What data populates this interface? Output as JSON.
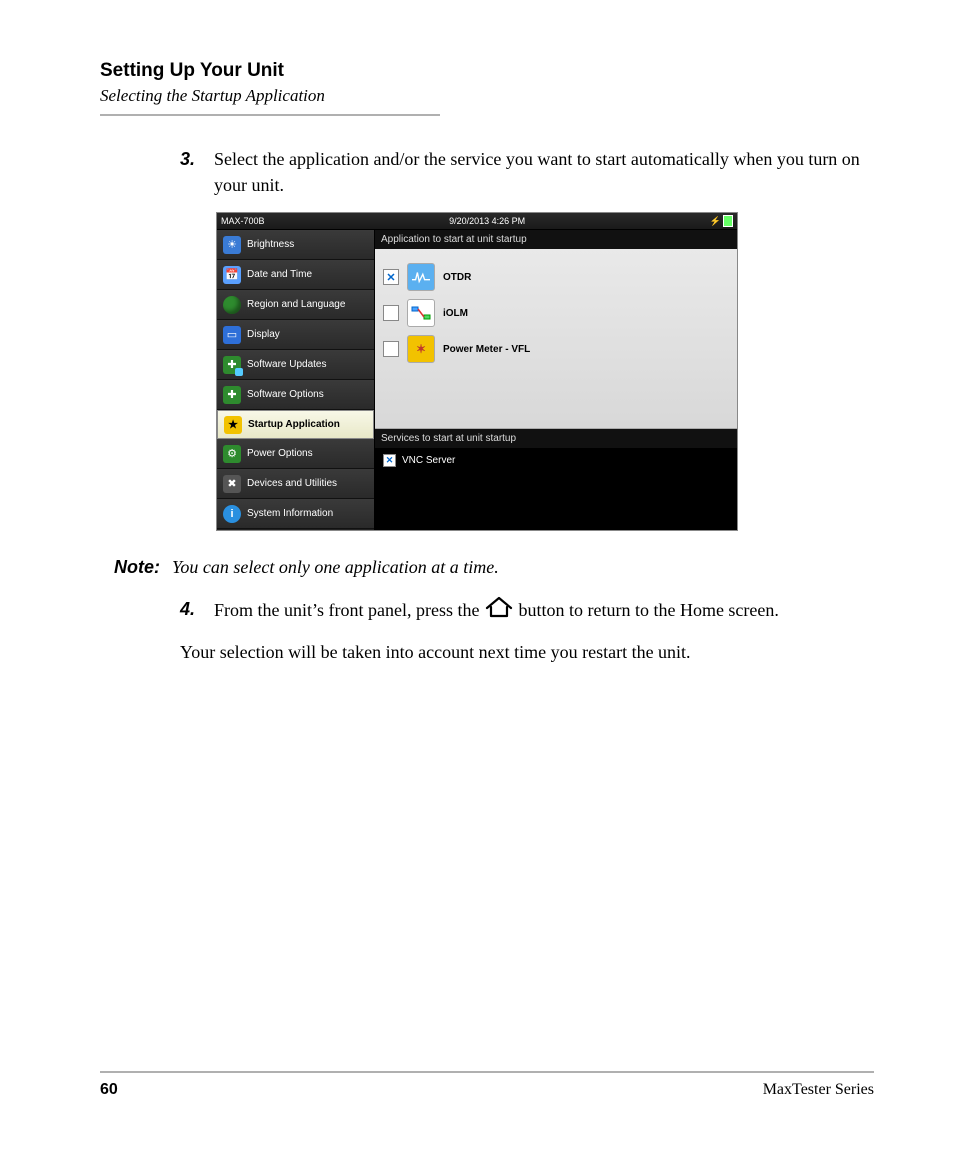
{
  "header": {
    "title": "Setting Up Your Unit",
    "subtitle": "Selecting the Startup Application"
  },
  "steps": {
    "s3": {
      "num": "3.",
      "text": "Select the application and/or the service you want to start automatically when you turn on your unit."
    },
    "s4": {
      "num": "4.",
      "pre": "From the unit’s front panel, press the ",
      "post": " button to return to the Home screen."
    }
  },
  "note": {
    "label": "Note:",
    "text": "You can select only one application at a time."
  },
  "closing": "Your selection will be taken into account next time you restart the unit.",
  "screenshot": {
    "device": "MAX-700B",
    "datetime": "9/20/2013 4:26 PM",
    "sidebar": [
      "Brightness",
      "Date and Time",
      "Region and Language",
      "Display",
      "Software Updates",
      "Software Options",
      "Startup Application",
      "Power Options",
      "Devices and Utilities",
      "System Information"
    ],
    "apps_header": "Application to start at unit startup",
    "apps": [
      {
        "label": "OTDR",
        "checked": true
      },
      {
        "label": "iOLM",
        "checked": false
      },
      {
        "label": "Power Meter - VFL",
        "checked": false
      }
    ],
    "services_header": "Services to start at unit startup",
    "services": [
      {
        "label": "VNC Server",
        "checked": true
      }
    ]
  },
  "footer": {
    "page": "60",
    "series": "MaxTester Series"
  }
}
